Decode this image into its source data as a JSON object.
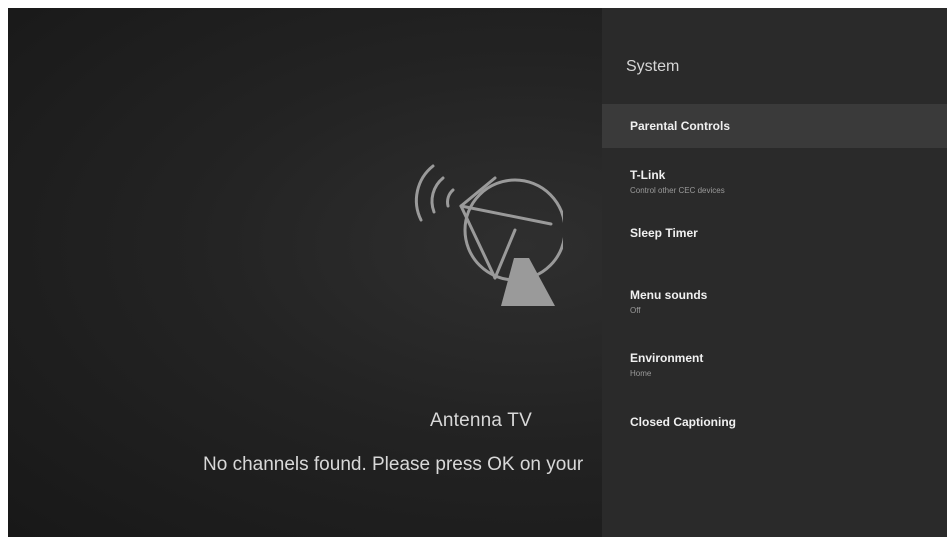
{
  "tv": {
    "source_title": "Antenna TV",
    "message": "No channels found. Please press OK on your"
  },
  "icons": {
    "antenna": "satellite-dish-icon"
  },
  "panel": {
    "title": "System",
    "items": [
      {
        "label": "Parental Controls",
        "subtitle": "",
        "focused": true
      },
      {
        "label": "T-Link",
        "subtitle": "Control other CEC devices",
        "focused": false
      },
      {
        "label": "Sleep Timer",
        "subtitle": "",
        "focused": false
      },
      {
        "label": "Menu sounds",
        "subtitle": "Off",
        "focused": false
      },
      {
        "label": "Environment",
        "subtitle": "Home",
        "focused": false
      },
      {
        "label": "Closed Captioning",
        "subtitle": "",
        "focused": false
      }
    ]
  },
  "colors": {
    "panel_background": "#2a2a2a",
    "focused_item": "#3a3a3a",
    "icon_stroke": "#9a9a9a"
  }
}
